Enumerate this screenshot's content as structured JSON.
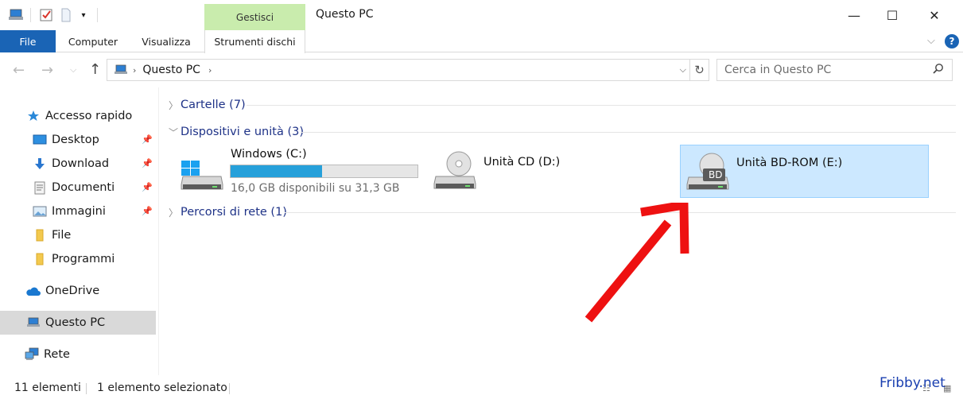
{
  "window": {
    "title": "Questo PC",
    "context_tab_group": "Gestisci",
    "minimize_glyph": "—",
    "maximize_glyph": "☐",
    "close_glyph": "✕"
  },
  "ribbon": {
    "tabs": [
      {
        "label": "File"
      },
      {
        "label": "Computer"
      },
      {
        "label": "Visualizza"
      },
      {
        "label": "Strumenti dischi"
      }
    ]
  },
  "address_bar": {
    "breadcrumb": [
      "Questo PC"
    ],
    "search_placeholder": "Cerca in Questo PC"
  },
  "nav_pane": {
    "items": [
      {
        "label": "Accesso rapido",
        "icon": "star-icon"
      },
      {
        "label": "Desktop",
        "icon": "desktop-icon",
        "pinned": true
      },
      {
        "label": "Download",
        "icon": "download-icon",
        "pinned": true
      },
      {
        "label": "Documenti",
        "icon": "documents-icon",
        "pinned": true
      },
      {
        "label": "Immagini",
        "icon": "pictures-icon",
        "pinned": true
      },
      {
        "label": "File",
        "icon": "folder-icon"
      },
      {
        "label": "Programmi",
        "icon": "folder-icon"
      },
      {
        "label": "OneDrive",
        "icon": "cloud-icon"
      },
      {
        "label": "Questo PC",
        "icon": "computer-icon",
        "selected": true
      },
      {
        "label": "Rete",
        "icon": "network-icon"
      }
    ]
  },
  "content": {
    "groups": {
      "folders": "Cartelle (7)",
      "devices": "Dispositivi e unità (3)",
      "network": "Percorsi di rete (1)"
    },
    "drives": [
      {
        "name": "Windows (C:)",
        "free_text": "16,0 GB disponibili su 31,3 GB",
        "used_fraction": 0.49
      },
      {
        "name": "Unità CD (D:)"
      },
      {
        "name": "Unità BD-ROM (E:)",
        "badge": "BD",
        "selected": true
      }
    ]
  },
  "status_bar": {
    "item_count": "11 elementi",
    "selection": "1 elemento selezionato"
  },
  "watermark": "Fribby.net",
  "colors": {
    "accent": "#1a64b5",
    "context_tab": "#c9ecad",
    "selection_bg": "#cce8ff",
    "progress_fill": "#26a0da",
    "annotation_arrow": "#ee1111"
  }
}
